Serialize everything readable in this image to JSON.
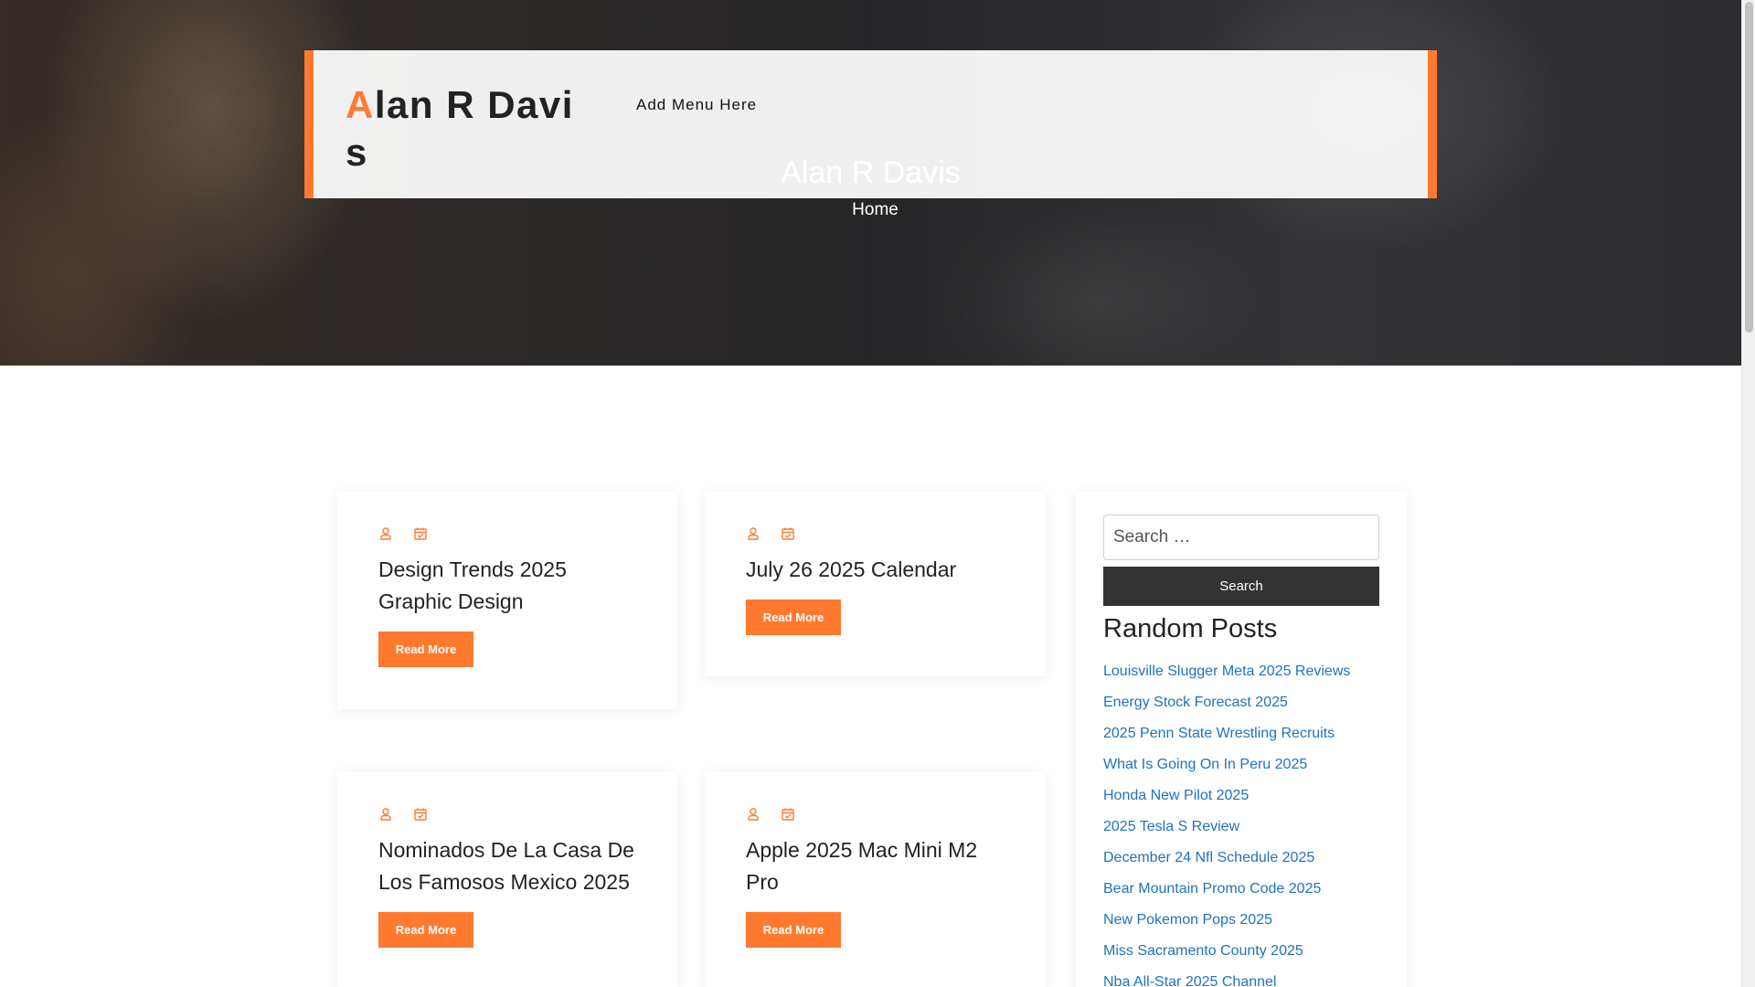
{
  "header": {
    "site_title_first": "A",
    "site_title_rest": "lan R Davis",
    "menu_link": "Add Menu Here"
  },
  "hero": {
    "title": "Alan R Davis",
    "breadcrumb": "Home"
  },
  "posts": [
    {
      "title": "Design Trends 2025 Graphic Design",
      "button": "Read More"
    },
    {
      "title": "July 26 2025 Calendar",
      "button": "Read More"
    },
    {
      "title": "Nominados De La Casa De Los Famosos Mexico 2025",
      "button": "Read More"
    },
    {
      "title": "Apple 2025 Mac Mini M2 Pro",
      "button": "Read More"
    }
  ],
  "icons": {
    "author": "user-icon",
    "date": "calendar-check-icon",
    "accent_color": "#ff7a2f"
  },
  "sidebar": {
    "search_placeholder": "Search …",
    "search_button": "Search",
    "random_posts_heading": "Random Posts",
    "random_posts": [
      "Louisville Slugger Meta 2025 Reviews",
      "Energy Stock Forecast 2025",
      "2025 Penn State Wrestling Recruits",
      "What Is Going On In Peru 2025",
      "Honda New Pilot 2025",
      "2025 Tesla S Review",
      "December 24 Nfl Schedule 2025",
      "Bear Mountain Promo Code 2025",
      "New Pokemon Pops 2025",
      "Miss Sacramento County 2025",
      "Nba All-Star 2025 Channel"
    ]
  }
}
